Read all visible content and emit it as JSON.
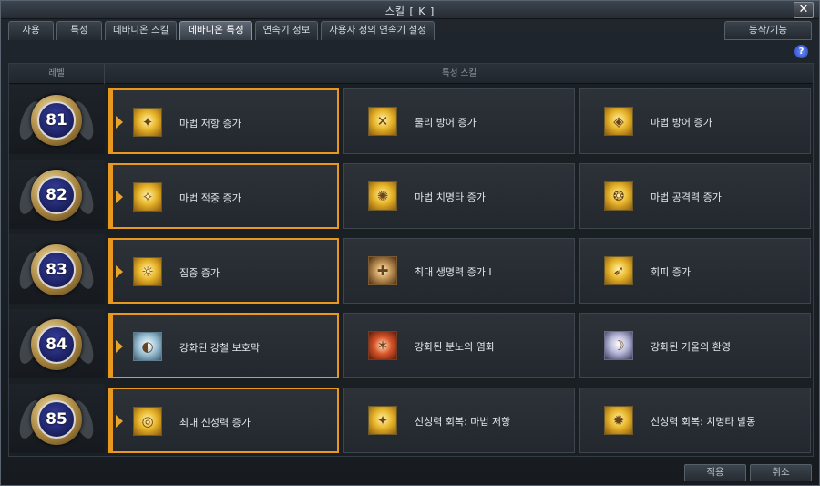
{
  "window": {
    "title": "스킬 [ K ]"
  },
  "tabs": [
    {
      "label": "사용",
      "active": false
    },
    {
      "label": "특성",
      "active": false
    },
    {
      "label": "데바니온 스킬",
      "active": false
    },
    {
      "label": "데바니온 특성",
      "active": true
    },
    {
      "label": "연속기 정보",
      "active": false
    },
    {
      "label": "사용자 정의 연속기 설정",
      "active": false
    }
  ],
  "action_tab": {
    "label": "동작/기능"
  },
  "help": {
    "label": "?"
  },
  "table": {
    "col_level": "레벨",
    "col_skill": "특성 스킬",
    "rows": [
      {
        "level": "81",
        "skills": [
          {
            "name": "마법 저항 증가",
            "icon": "magic-resist-icon",
            "selected": true
          },
          {
            "name": "물리 방어 증가",
            "icon": "physical-defense-icon",
            "selected": false
          },
          {
            "name": "마법 방어 증가",
            "icon": "magic-defense-icon",
            "selected": false
          }
        ]
      },
      {
        "level": "82",
        "skills": [
          {
            "name": "마법 적중 증가",
            "icon": "magic-accuracy-icon",
            "selected": true
          },
          {
            "name": "마법 치명타 증가",
            "icon": "magic-critical-icon",
            "selected": false
          },
          {
            "name": "마법 공격력 증가",
            "icon": "magic-attack-icon",
            "selected": false
          }
        ]
      },
      {
        "level": "83",
        "skills": [
          {
            "name": "집중 증가",
            "icon": "concentration-icon",
            "selected": true
          },
          {
            "name": "최대 생명력 증가 I",
            "icon": "max-hp-icon",
            "selected": false
          },
          {
            "name": "회피 증가",
            "icon": "evasion-icon",
            "selected": false
          }
        ]
      },
      {
        "level": "84",
        "skills": [
          {
            "name": "강화된 강철 보호막",
            "icon": "steel-shield-icon",
            "selected": true
          },
          {
            "name": "강화된 분노의 염화",
            "icon": "wrath-flame-icon",
            "selected": false
          },
          {
            "name": "강화된 거울의 환영",
            "icon": "mirror-illusion-icon",
            "selected": false
          }
        ]
      },
      {
        "level": "85",
        "skills": [
          {
            "name": "최대 신성력 증가",
            "icon": "max-dp-icon",
            "selected": true
          },
          {
            "name": "신성력 회복: 마법 저항",
            "icon": "dp-recovery-resist-icon",
            "selected": false
          },
          {
            "name": "신성력 회복: 치명타 발동",
            "icon": "dp-recovery-critical-icon",
            "selected": false
          }
        ]
      }
    ]
  },
  "footer": {
    "apply_label": "적용",
    "cancel_label": "취소"
  },
  "colors": {
    "accent": "#e8971f",
    "level_badge": "#1a1e5a",
    "help": "#2743b8"
  }
}
